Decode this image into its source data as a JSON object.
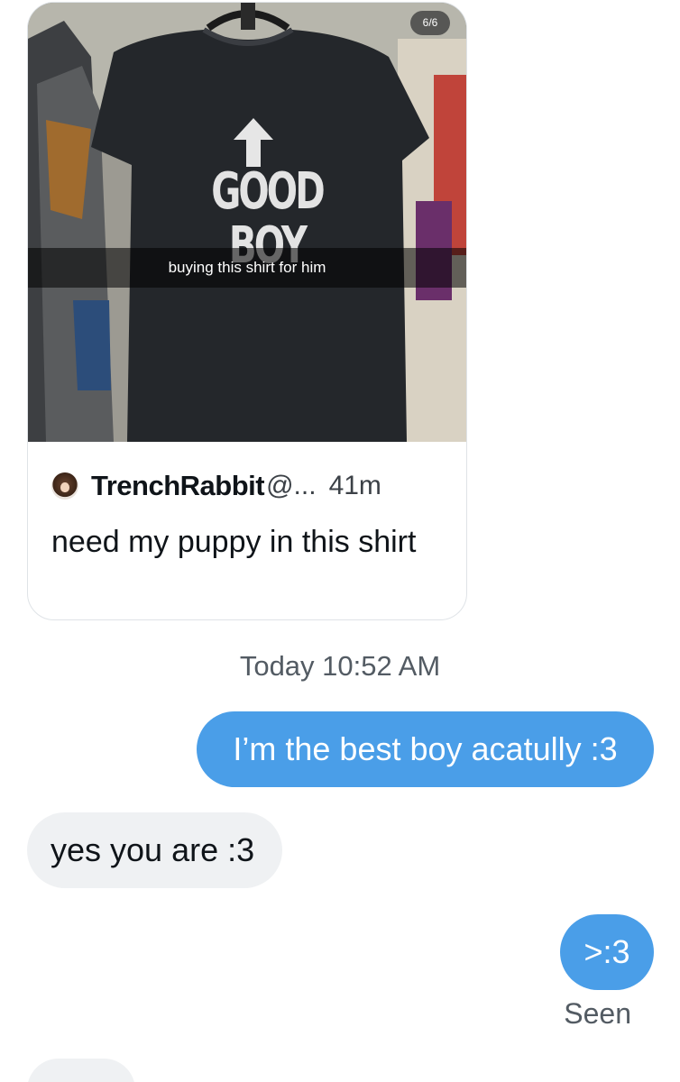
{
  "shared_post": {
    "media_counter": "6/6",
    "shirt_print": "GOOD BOY",
    "media_caption": "buying this shirt for him",
    "author_name": "TrenchRabbit",
    "author_handle": "@...",
    "time_ago": "41m",
    "text": "need my puppy in this shirt"
  },
  "conversation": {
    "timestamp": "Today 10:52 AM",
    "messages": [
      {
        "direction": "sent",
        "text": "I’m the best boy acatully :3"
      },
      {
        "direction": "received",
        "text": "yes you are :3"
      },
      {
        "direction": "sent",
        "text": ">:3"
      }
    ],
    "status": "Seen"
  },
  "colors": {
    "sent_bubble": "#4a9ee8",
    "received_bubble": "#eff1f3"
  }
}
